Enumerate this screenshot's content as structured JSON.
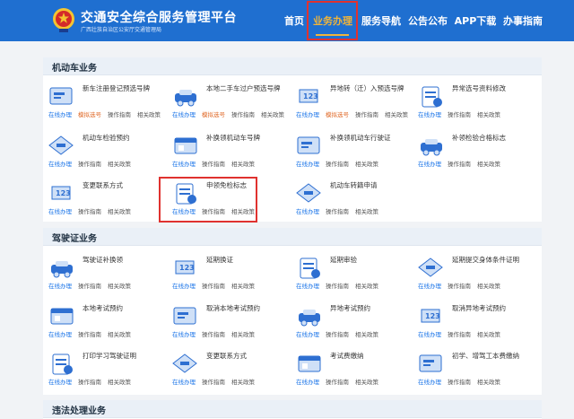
{
  "header": {
    "title": "交通安全综合服务管理平台",
    "subtitle": "广西壮族自治区公安厅交通管理局",
    "nav": [
      "首页",
      "业务办理",
      "服务导航",
      "公告公布",
      "APP下载",
      "办事指南"
    ],
    "active_nav": "业务办理",
    "colors": {
      "bar": "#1f6fd0",
      "active": "#f0b43a",
      "highlight": "#e0322f"
    }
  },
  "sections": [
    {
      "title": "机动车业务",
      "items": [
        {
          "name": "新车注册登记预选号牌",
          "icon": "car-registration-icon",
          "links": [
            "在线办理",
            "模拟选号",
            "操作指南",
            "相关政策"
          ]
        },
        {
          "name": "本地二手车过户预选号牌",
          "icon": "used-car-transfer-icon",
          "links": [
            "在线办理",
            "模拟选号",
            "操作指南",
            "相关政策"
          ]
        },
        {
          "name": "异地转（迁）入预选号牌",
          "icon": "car-transfer-in-icon",
          "links": [
            "在线办理",
            "模拟选号",
            "操作指南",
            "相关政策"
          ]
        },
        {
          "name": "异常选号资料修改",
          "icon": "plate-edit-icon",
          "links": [
            "在线办理",
            "操作指南",
            "相关政策"
          ]
        },
        {
          "name": "机动车检验预约",
          "icon": "inspection-booking-icon",
          "links": [
            "在线办理",
            "操作指南",
            "相关政策"
          ]
        },
        {
          "name": "补换领机动车号牌",
          "icon": "plate-replace-icon",
          "links": [
            "在线办理",
            "操作指南",
            "相关政策"
          ]
        },
        {
          "name": "补换领机动车行驶证",
          "icon": "vehicle-license-icon",
          "links": [
            "在线办理",
            "操作指南",
            "相关政策"
          ]
        },
        {
          "name": "补领检验合格标志",
          "icon": "inspection-mark-icon",
          "links": [
            "在线办理",
            "操作指南",
            "相关政策"
          ]
        },
        {
          "name": "变更联系方式",
          "icon": "contact-change-icon",
          "links": [
            "在线办理",
            "操作指南",
            "相关政策"
          ]
        },
        {
          "name": "申领免检标志",
          "icon": "exempt-mark-icon",
          "links": [
            "在线办理",
            "操作指南",
            "相关政策"
          ]
        },
        {
          "name": "机动车转籍申请",
          "icon": "transfer-application-icon",
          "links": [
            "在线办理",
            "操作指南",
            "相关政策"
          ]
        }
      ]
    },
    {
      "title": "驾驶证业务",
      "items": [
        {
          "name": "驾驶证补换领",
          "icon": "driver-license-icon",
          "links": [
            "在线办理",
            "操作指南",
            "相关政策"
          ]
        },
        {
          "name": "延期换证",
          "icon": "extend-renewal-icon",
          "links": [
            "在线办理",
            "操作指南",
            "相关政策"
          ]
        },
        {
          "name": "延期审验",
          "icon": "extend-review-icon",
          "links": [
            "在线办理",
            "操作指南",
            "相关政策"
          ]
        },
        {
          "name": "延期提交身体条件证明",
          "icon": "health-proof-icon",
          "links": [
            "在线办理",
            "操作指南",
            "相关政策"
          ]
        },
        {
          "name": "本地考试预约",
          "icon": "exam-booking-icon",
          "links": [
            "在线办理",
            "操作指南",
            "相关政策"
          ]
        },
        {
          "name": "取消本地考试预约",
          "icon": "cancel-exam-icon",
          "links": [
            "在线办理",
            "操作指南",
            "相关政策"
          ]
        },
        {
          "name": "异地考试预约",
          "icon": "remote-exam-icon",
          "links": [
            "在线办理",
            "操作指南",
            "相关政策"
          ]
        },
        {
          "name": "取消异地考试预约",
          "icon": "cancel-remote-exam-icon",
          "links": [
            "在线办理",
            "操作指南",
            "相关政策"
          ]
        },
        {
          "name": "打印学习驾驶证明",
          "icon": "print-proof-icon",
          "links": [
            "在线办理",
            "操作指南",
            "相关政策"
          ]
        },
        {
          "name": "变更联系方式",
          "icon": "contact-change-icon",
          "links": [
            "在线办理",
            "操作指南",
            "相关政策"
          ]
        },
        {
          "name": "考试费缴纳",
          "icon": "exam-fee-icon",
          "links": [
            "在线办理",
            "操作指南",
            "相关政策"
          ]
        },
        {
          "name": "初学、增驾工本费缴纳",
          "icon": "fee-payment-icon",
          "links": [
            "在线办理",
            "操作指南",
            "相关政策"
          ]
        }
      ]
    },
    {
      "title": "违法处理业务",
      "items": []
    }
  ]
}
